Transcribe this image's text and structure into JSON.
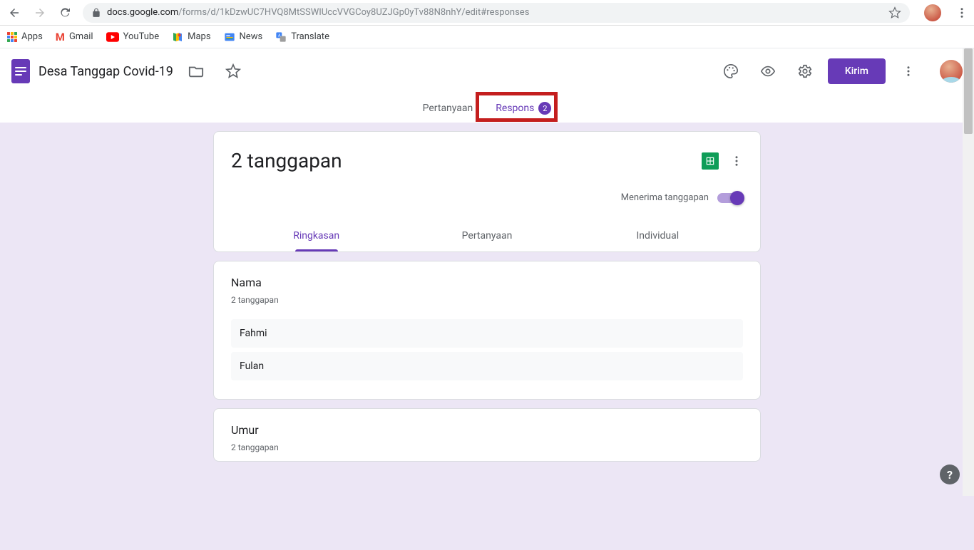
{
  "browser": {
    "url_host": "docs.google.com",
    "url_path": "/forms/d/1kDzwUC7HVQ8MtSSWIUccVVGCoy8UZJGp0yTv88N8nhY/edit#responses"
  },
  "bookmarks": {
    "apps": "Apps",
    "gmail": "Gmail",
    "youtube": "YouTube",
    "maps": "Maps",
    "news": "News",
    "translate": "Translate"
  },
  "header": {
    "title": "Desa Tanggap Covid-19",
    "send": "Kirim"
  },
  "tabs": {
    "questions": "Pertanyaan",
    "responses": "Respons",
    "responses_count": "2"
  },
  "responses": {
    "heading": "2 tanggapan",
    "accept_label": "Menerima tanggapan",
    "subtabs": {
      "summary": "Ringkasan",
      "question": "Pertanyaan",
      "individual": "Individual"
    }
  },
  "sections": [
    {
      "title": "Nama",
      "subtitle": "2 tanggapan",
      "answers": [
        "Fahmi",
        "Fulan"
      ]
    },
    {
      "title": "Umur",
      "subtitle": "2 tanggapan",
      "answers": []
    }
  ],
  "help": "?"
}
